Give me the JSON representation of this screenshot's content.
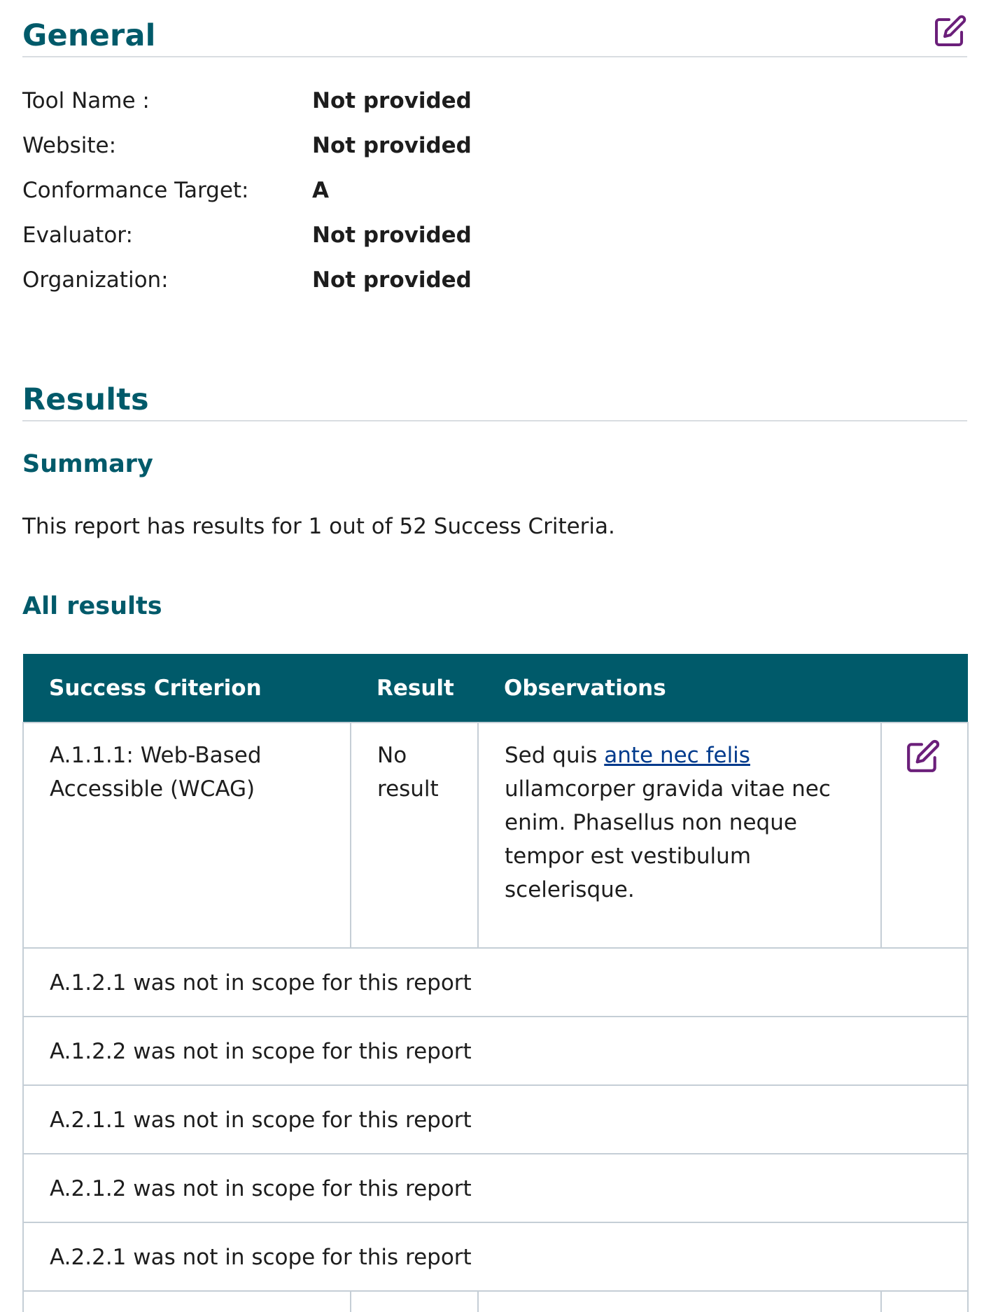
{
  "general": {
    "heading": "General",
    "details": [
      {
        "label": "Tool Name :",
        "value": "Not provided"
      },
      {
        "label": "Website:",
        "value": "Not provided"
      },
      {
        "label": "Conformance Target:",
        "value": "A"
      },
      {
        "label": "Evaluator:",
        "value": "Not provided"
      },
      {
        "label": "Organization:",
        "value": "Not provided"
      }
    ]
  },
  "results": {
    "heading": "Results",
    "summary": {
      "heading": "Summary",
      "text": "This report has results for 1 out of 52 Success Criteria."
    },
    "all_results": {
      "heading": "All results",
      "columns": [
        "Success Criterion",
        "Result",
        "Observations"
      ],
      "rows": [
        {
          "criterion": "A.1.1.1: Web-Based Accessible (WCAG)",
          "result": "No result",
          "observation_before": "Sed quis ",
          "observation_link": "ante nec felis",
          "observation_after": " ullamcorper gravida vitae nec enim. Phasellus non neque tempor est vestibulum scelerisque."
        }
      ],
      "out_of_scope": [
        "A.1.2.1 was not in scope for this report",
        "A.1.2.2 was not in scope for this report",
        "A.2.1.1 was not in scope for this report",
        "A.2.1.2 was not in scope for this report",
        "A.2.2.1 was not in scope for this report"
      ]
    }
  },
  "icons": {
    "edit": "edit-icon"
  },
  "colors": {
    "heading": "#005a6a",
    "table_header_bg": "#005a6a",
    "edit_icon": "#6b1f7a",
    "link": "#003a8c",
    "border": "#c5ced6"
  }
}
